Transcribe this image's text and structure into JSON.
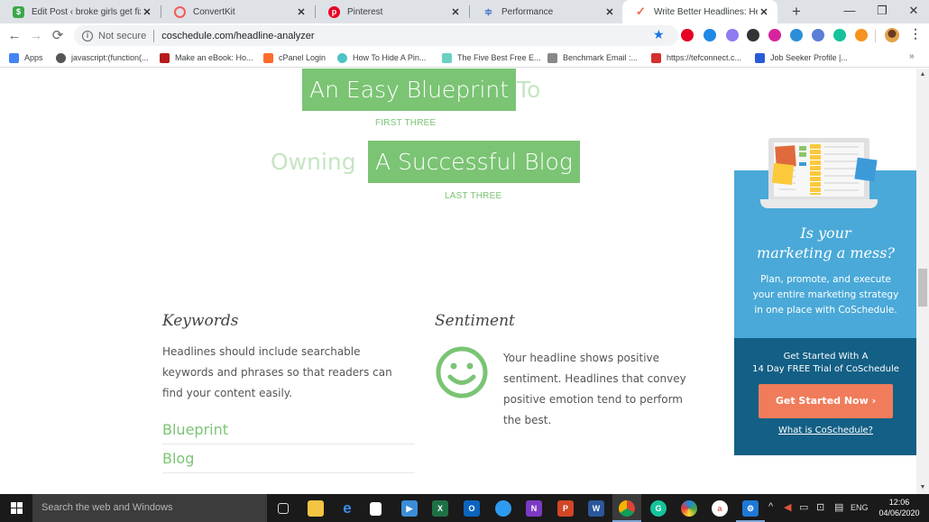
{
  "browser": {
    "tabs": [
      {
        "title": "Edit Post ‹ broke girls get fixed",
        "favicon": "money-icon",
        "color": "#3aa84a",
        "active": false
      },
      {
        "title": "ConvertKit",
        "favicon": "convertkit-icon",
        "color": "#f25c5c",
        "active": false
      },
      {
        "title": "Pinterest",
        "favicon": "pinterest-icon",
        "color": "#e60023",
        "active": false
      },
      {
        "title": "Performance",
        "favicon": "performance-icon",
        "color": "#4a76c7",
        "active": false
      },
      {
        "title": "Write Better Headlines: Headli",
        "favicon": "coschedule-icon",
        "color": "#ef6a4a",
        "active": true
      }
    ],
    "close_glyph": "✕",
    "new_tab_glyph": "+",
    "window_controls": {
      "minimize": "—",
      "restore": "❐",
      "close": "✕"
    },
    "nav": {
      "back": "←",
      "forward": "→",
      "reload": "⟳"
    },
    "address": {
      "security_label": "Not secure",
      "url": "coschedule.com/headline-analyzer"
    },
    "extensions": [
      {
        "name": "pinterest-ext-icon",
        "color": "#e60023"
      },
      {
        "name": "ext-s-icon",
        "color": "#1e88e5"
      },
      {
        "name": "ext-ring-icon",
        "color": "#8e7cf0"
      },
      {
        "name": "ext-download-icon",
        "color": "#333333"
      },
      {
        "name": "instagram-ext-icon",
        "color": "#d6249f"
      },
      {
        "name": "ext-wave-icon",
        "color": "#2a8fd8"
      },
      {
        "name": "camera-ext-icon",
        "color": "#5b7fd6"
      },
      {
        "name": "grammarly-ext-icon",
        "color": "#15c39a"
      },
      {
        "name": "ext-m-icon",
        "color": "#f7931e"
      }
    ],
    "bookmarks": [
      {
        "label": "Apps",
        "icon": "apps-grid-icon",
        "color": "#4285f4"
      },
      {
        "label": "javascript:(function(...",
        "icon": "globe-icon",
        "color": "#555555"
      },
      {
        "label": "Make an eBook: Ho...",
        "icon": "star-icon",
        "color": "#b71c1c"
      },
      {
        "label": "cPanel Login",
        "icon": "cpanel-icon",
        "color": "#ff6c2c"
      },
      {
        "label": "How To Hide A Pin...",
        "icon": "bookmark-circle-icon",
        "color": "#4fc3c7"
      },
      {
        "label": "The Five Best Free E...",
        "icon": "lines-icon",
        "color": "#6ccfc2"
      },
      {
        "label": "Benchmark Email :...",
        "icon": "feather-icon",
        "color": "#888888"
      },
      {
        "label": "https://tefconnect.c...",
        "icon": "tef-icon",
        "color": "#d32f2f"
      },
      {
        "label": "Job Seeker Profile |...",
        "icon": "job-icon",
        "color": "#2a5bd7"
      }
    ],
    "bookmarks_more": "»"
  },
  "headline": {
    "line1": {
      "highlighted": "An Easy Blueprint",
      "faded": "To"
    },
    "label_first": "FIRST THREE",
    "line2": {
      "faded": "Owning",
      "highlighted": "A Successful Blog"
    },
    "label_last": "LAST THREE"
  },
  "keywords": {
    "title": "Keywords",
    "body": "Headlines should include searchable keywords and phrases so that readers can find your content easily.",
    "items": [
      "Blueprint",
      "Blog"
    ]
  },
  "sentiment": {
    "title": "Sentiment",
    "status": "positive",
    "body": "Your headline shows positive sentiment. Headlines that convey positive emotion tend to perform the best."
  },
  "ad": {
    "title_line1": "Is your",
    "title_line2": "marketing a mess?",
    "body_lines": [
      "Plan, promote, and execute",
      "your entire marketing strategy",
      "in one place with CoSchedule."
    ],
    "cta_line1": "Get Started With A",
    "cta_line2": "14 Day FREE Trial of CoSchedule",
    "button": "Get Started Now ›",
    "link": "What is CoSchedule?"
  },
  "colors": {
    "accent_green": "#7bc474",
    "ad_blue": "#4aa9d8",
    "ad_dark": "#135f85",
    "cta_orange": "#f07c5b"
  },
  "taskbar": {
    "search_placeholder": "Search the web and Windows",
    "apps": [
      {
        "name": "task-view-icon",
        "label": "",
        "color": "transparent"
      },
      {
        "name": "file-explorer-icon",
        "label": "",
        "color": "#f4c542"
      },
      {
        "name": "edge-icon",
        "label": "e",
        "color": "transparent"
      },
      {
        "name": "store-icon",
        "label": "",
        "color": "transparent"
      },
      {
        "name": "media-player-icon",
        "label": "▶",
        "color": "#3b8ed6"
      },
      {
        "name": "excel-icon",
        "label": "X",
        "color": "#1e7145"
      },
      {
        "name": "outlook-icon",
        "label": "O",
        "color": "#0b64c0"
      },
      {
        "name": "paint-3d-icon",
        "label": "",
        "color": "#2d9bf0"
      },
      {
        "name": "onenote-icon",
        "label": "N",
        "color": "#7c3ac5"
      },
      {
        "name": "powerpoint-icon",
        "label": "P",
        "color": "#d24726"
      },
      {
        "name": "word-icon",
        "label": "W",
        "color": "#2b579a"
      },
      {
        "name": "chrome-icon",
        "label": "",
        "color": "transparent"
      },
      {
        "name": "grammarly-icon",
        "label": "G",
        "color": "#15c39a"
      },
      {
        "name": "colorful-app-icon",
        "label": "",
        "color": "transparent"
      },
      {
        "name": "app-a-icon",
        "label": "a",
        "color": "#ffffff"
      },
      {
        "name": "settings-icon",
        "label": "⚙",
        "color": "#1e78d7"
      }
    ],
    "tray": {
      "chevron": "^",
      "language": "ENG"
    },
    "clock": {
      "time": "12:06",
      "date": "04/06/2020"
    }
  }
}
